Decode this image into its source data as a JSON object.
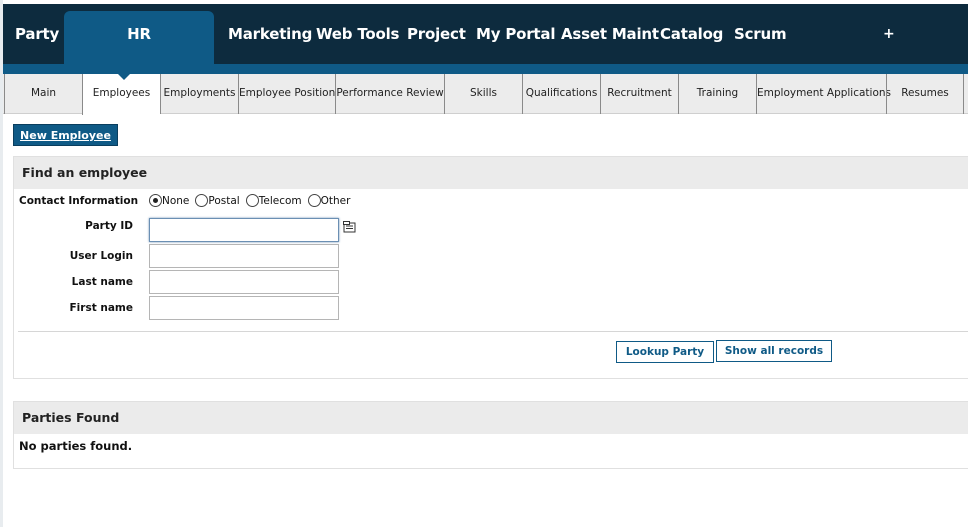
{
  "topnav": {
    "tabs": [
      {
        "label": "Party"
      },
      {
        "label": "HR",
        "active": true
      },
      {
        "label": "Marketing"
      },
      {
        "label": "Web Tools"
      },
      {
        "label": "Project"
      },
      {
        "label": "My Portal"
      },
      {
        "label": "Asset Maint"
      },
      {
        "label": "Catalog"
      },
      {
        "label": "Scrum"
      }
    ],
    "add_label": "+"
  },
  "subnav": {
    "tabs": [
      {
        "label": "Main"
      },
      {
        "label": "Employees",
        "active": true
      },
      {
        "label": "Employments"
      },
      {
        "label": "Employee Position"
      },
      {
        "label": "Performance Review"
      },
      {
        "label": "Skills"
      },
      {
        "label": "Qualifications"
      },
      {
        "label": "Recruitment"
      },
      {
        "label": "Training"
      },
      {
        "label": "Employment Applications"
      },
      {
        "label": "Resumes"
      }
    ]
  },
  "new_employee_label": "New Employee",
  "find": {
    "title": "Find an employee",
    "contact_label": "Contact Information",
    "contact_options": [
      "None",
      "Postal",
      "Telecom",
      "Other"
    ],
    "contact_selected": "None",
    "fields": {
      "party_id": {
        "label": "Party ID",
        "value": ""
      },
      "user_login": {
        "label": "User Login",
        "value": ""
      },
      "last_name": {
        "label": "Last name",
        "value": ""
      },
      "first_name": {
        "label": "First name",
        "value": ""
      }
    },
    "lookup_button": "Lookup Party",
    "show_all_button": "Show all records"
  },
  "found": {
    "title": "Parties Found",
    "empty_message": "No parties found."
  },
  "icons": {
    "lookup": "lookup-icon"
  },
  "colors": {
    "nav_dark": "#0d2b3e",
    "accent": "#0f5a86"
  }
}
